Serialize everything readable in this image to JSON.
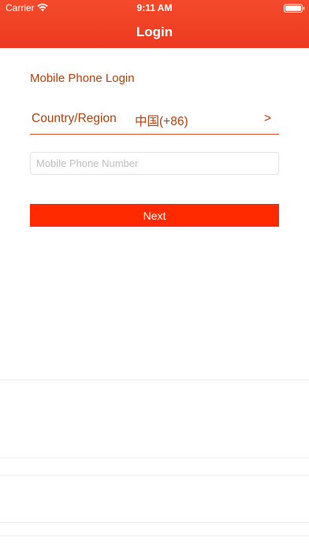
{
  "status_bar": {
    "carrier": "Carrier",
    "time": "9:11 AM",
    "icons": [
      "wifi-icon",
      "battery-icon"
    ]
  },
  "nav": {
    "title": "Login"
  },
  "login": {
    "section_title": "Mobile Phone Login",
    "country_label": "Country/Region",
    "country_value": "中国(+86)",
    "chevron": ">",
    "phone_placeholder": "Mobile Phone Number",
    "phone_value": "",
    "next_label": "Next"
  },
  "colors": {
    "header": "#f04428",
    "accent_text": "#b3400e",
    "button": "#ff2a00",
    "underline": "#e8512c"
  }
}
